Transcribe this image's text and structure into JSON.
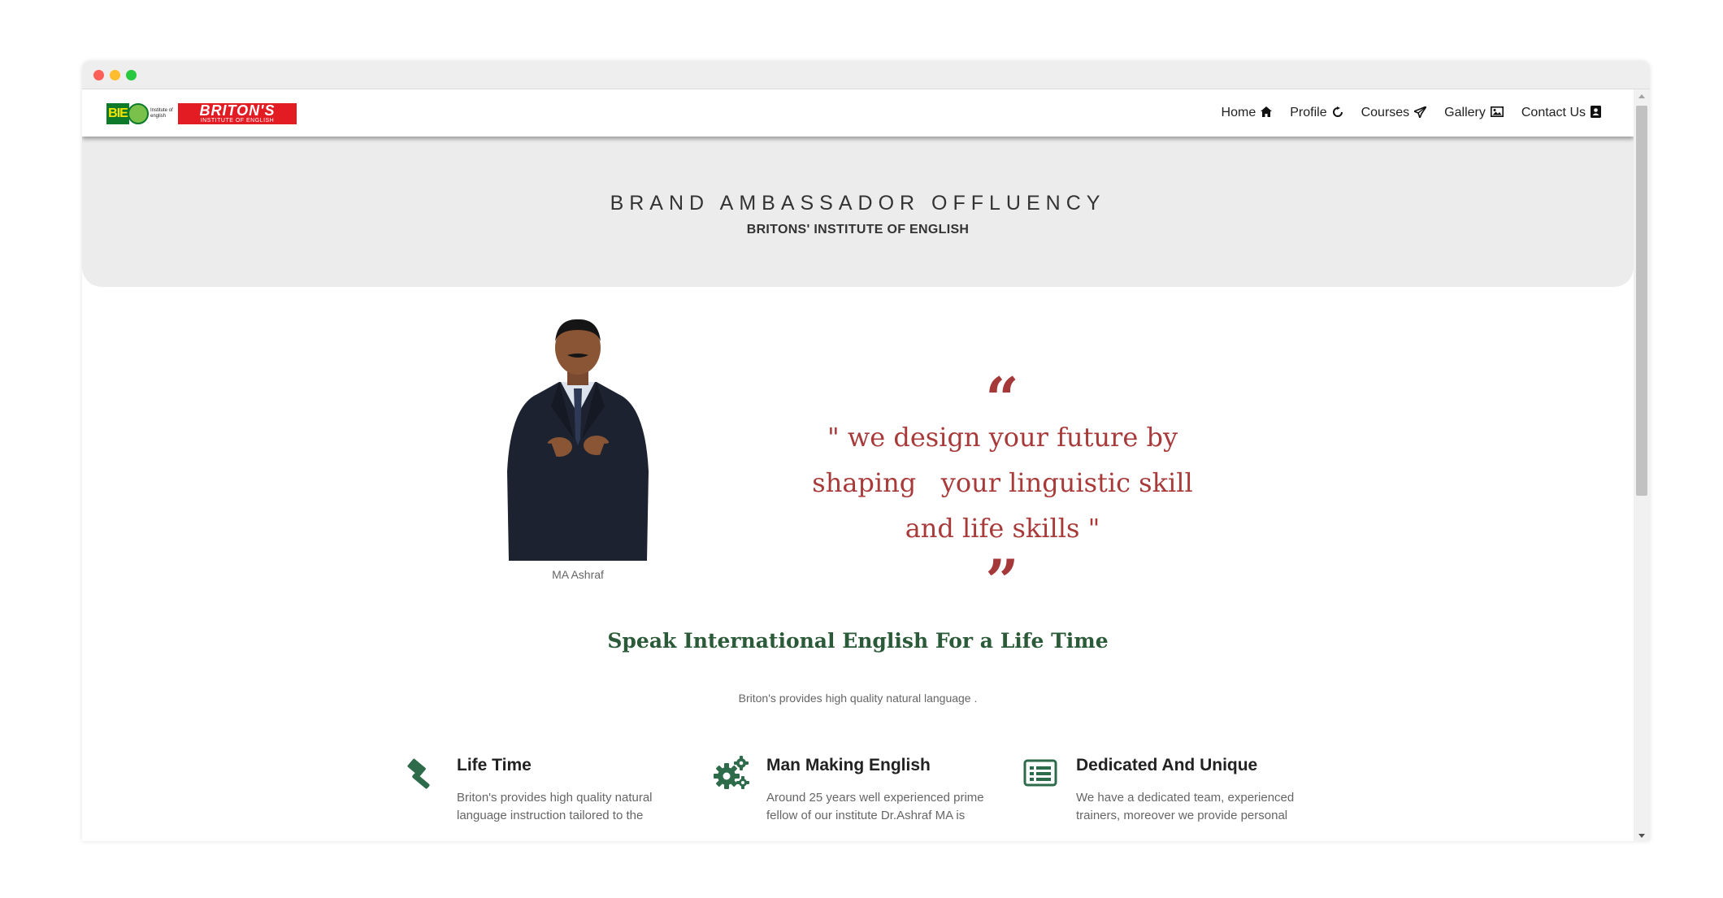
{
  "nav": {
    "logo": {
      "bie": "BIE",
      "tagline": "Institute of english",
      "brand": "BRITON'S",
      "brand_sub": "INSTITUTE OF ENGLISH"
    },
    "items": [
      {
        "label": "Home",
        "icon": "home-icon"
      },
      {
        "label": "Profile",
        "icon": "refresh-icon"
      },
      {
        "label": "Courses",
        "icon": "paper-plane-icon"
      },
      {
        "label": "Gallery",
        "icon": "image-icon"
      },
      {
        "label": "Contact Us",
        "icon": "contact-book-icon"
      }
    ]
  },
  "hero": {
    "title": "BRAND AMBASSADOR OFFLUENCY",
    "subtitle": "BRITONS' INSTITUTE OF ENGLISH"
  },
  "ambassador": {
    "name": "MA Ashraf"
  },
  "quote": {
    "open_mark": "“",
    "close_mark": "”",
    "text": "\" we design your future by\nshaping   your linguistic skill\nand life skills \""
  },
  "section": {
    "title": "Speak International English For a Life Time",
    "subtitle": "Briton's provides high quality natural language ."
  },
  "features": [
    {
      "title": "Life Time",
      "icon": "gavel-icon",
      "text": "Briton's provides high quality natural language instruction tailored to the"
    },
    {
      "title": "Man Making English",
      "icon": "gears-icon",
      "text": "Around 25 years well experienced prime fellow of our institute Dr.Ashraf MA is"
    },
    {
      "title": "Dedicated And Unique",
      "icon": "list-icon",
      "text": "We have a dedicated team, experienced trainers, moreover we provide personal"
    }
  ],
  "colors": {
    "quote": "#a83a3a",
    "section_title": "#2b5a38",
    "feature_icon": "#2e6b4a",
    "hero_bg": "#ececec",
    "logo_red": "#e31b23"
  }
}
